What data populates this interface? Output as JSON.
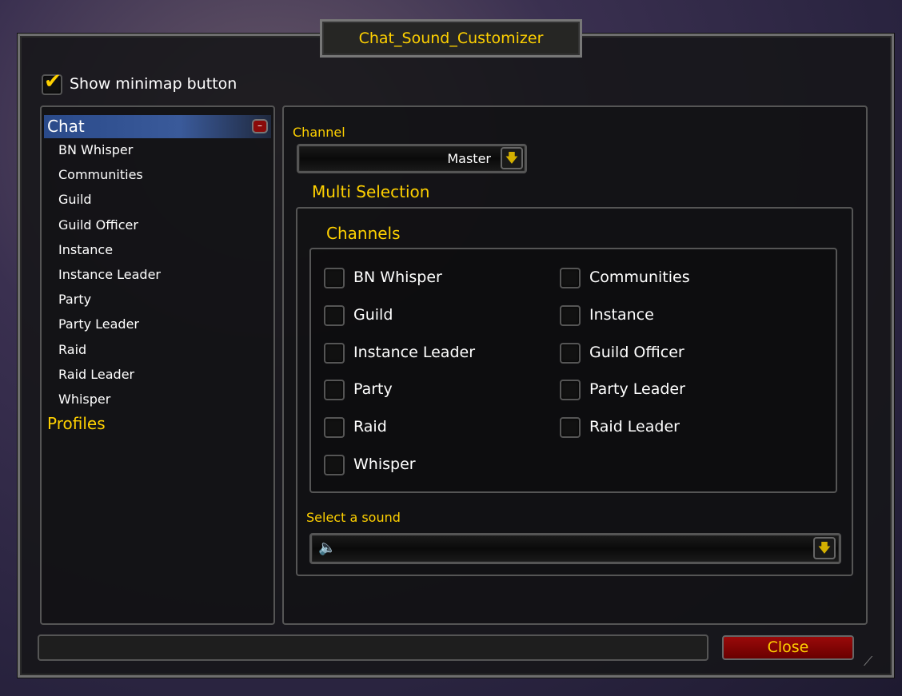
{
  "window": {
    "title": "Chat_Sound_Customizer"
  },
  "minimap": {
    "label": "Show minimap button",
    "checked": true
  },
  "tree": {
    "items": [
      {
        "label": "Chat",
        "selected": true,
        "expanded": true
      },
      {
        "label": "BN Whisper"
      },
      {
        "label": "Communities"
      },
      {
        "label": "Guild"
      },
      {
        "label": "Guild Officer"
      },
      {
        "label": "Instance"
      },
      {
        "label": "Instance Leader"
      },
      {
        "label": "Party"
      },
      {
        "label": "Party Leader"
      },
      {
        "label": "Raid"
      },
      {
        "label": "Raid Leader"
      },
      {
        "label": "Whisper"
      }
    ],
    "profiles": "Profiles"
  },
  "channel": {
    "label": "Channel",
    "value": "Master"
  },
  "multi": {
    "title": "Multi Selection",
    "group": "Channels",
    "options": [
      {
        "label": "BN Whisper",
        "checked": false
      },
      {
        "label": "Communities",
        "checked": false
      },
      {
        "label": "Guild",
        "checked": false
      },
      {
        "label": "Instance",
        "checked": false
      },
      {
        "label": "Instance Leader",
        "checked": false
      },
      {
        "label": "Guild Officer",
        "checked": false
      },
      {
        "label": "Party",
        "checked": false
      },
      {
        "label": "Party Leader",
        "checked": false
      },
      {
        "label": "Raid",
        "checked": false
      },
      {
        "label": "Raid Leader",
        "checked": false
      },
      {
        "label": "Whisper",
        "checked": false
      }
    ]
  },
  "sound": {
    "label": "Select a sound",
    "value": "",
    "icon": "speaker-icon"
  },
  "footer": {
    "status": "",
    "close": "Close"
  },
  "colors": {
    "accent": "#ffd100",
    "close_button": "#8a0000",
    "selection": "#3a5a9a"
  }
}
